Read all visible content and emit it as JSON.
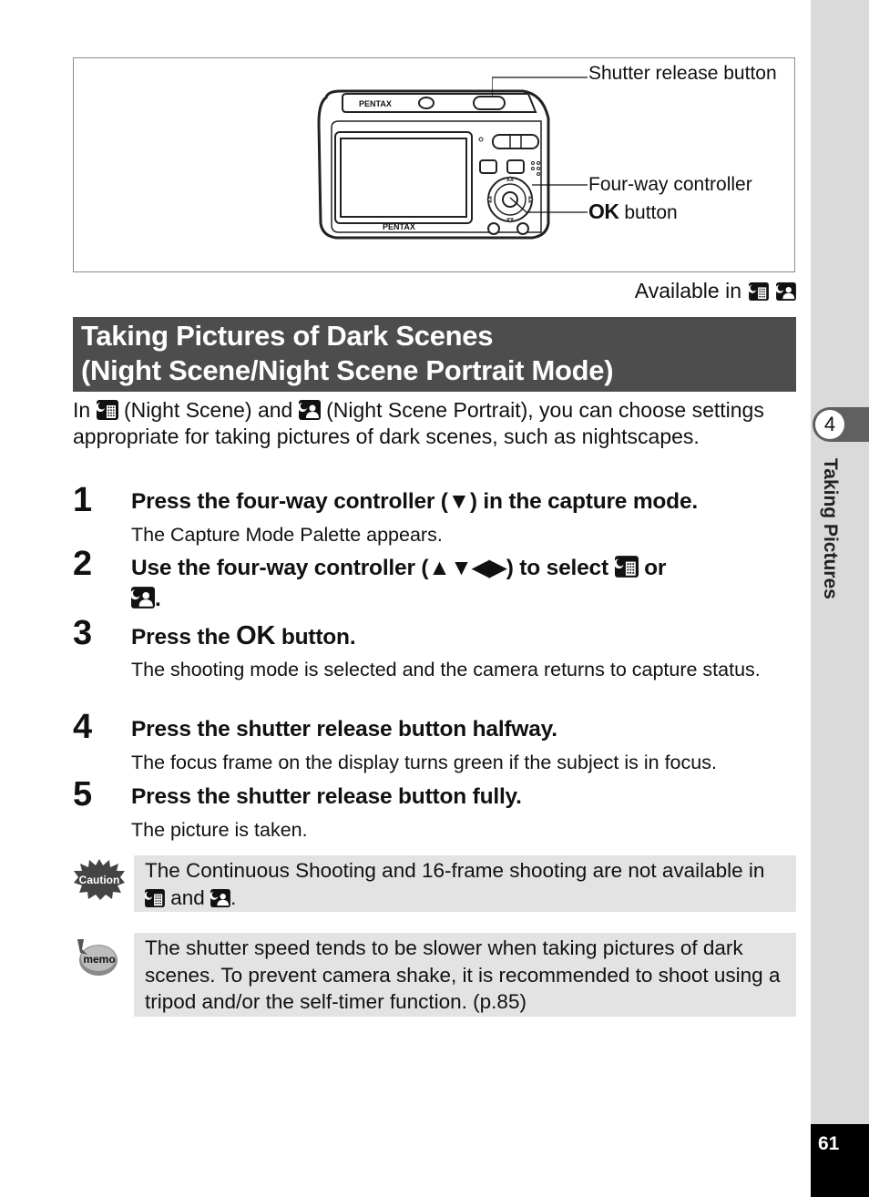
{
  "figure": {
    "brand_top": "PENTAX",
    "brand_bottom": "PENTAX",
    "callouts": {
      "shutter": "Shutter release button",
      "four_way": "Four-way controller",
      "ok_glyph": "OK",
      "ok_suffix": "button"
    }
  },
  "available": {
    "label": "Available in",
    "icons": [
      "night-scene-icon",
      "night-scene-portrait-icon"
    ]
  },
  "title": {
    "line1": "Taking Pictures of Dark Scenes",
    "line2": "(Night Scene/Night Scene Portrait Mode)"
  },
  "intro": {
    "part1": "In",
    "part2": "(Night Scene) and",
    "part3": "(Night Scene Portrait), you can choose settings appropriate for taking pictures of dark scenes, such as nightscapes."
  },
  "steps": [
    {
      "num": "1",
      "head": "Press the four-way controller (▼) in the capture mode.",
      "body": "The Capture Mode Palette appears."
    },
    {
      "num": "2",
      "head_a": "Use the four-way controller (▲▼◀▶) to select",
      "head_b": "or",
      "head_c": "."
    },
    {
      "num": "3",
      "head_a": "Press the",
      "ok": "OK",
      "head_b": "button.",
      "body": "The shooting mode is selected and the camera returns to capture status."
    },
    {
      "num": "4",
      "head": "Press the shutter release button halfway.",
      "body": "The focus frame on the display turns green if the subject is in focus."
    },
    {
      "num": "5",
      "head": "Press the shutter release button fully.",
      "body": "The picture is taken."
    }
  ],
  "caution": {
    "icon_label": "Caution",
    "text_a": "The Continuous Shooting and 16-frame shooting are not available in",
    "text_b": "and",
    "text_c": "."
  },
  "memo": {
    "icon_label": "memo",
    "text": "The shutter speed tends to be slower when taking pictures of dark scenes. To prevent camera shake, it is recommended to shoot using a tripod and/or the self-timer function. (p.85)"
  },
  "side_tab": {
    "chapter_number": "4",
    "chapter_title": "Taking Pictures"
  },
  "page_number": "61",
  "colors": {
    "title_bar": "#4d4d4d",
    "note_bg": "#e3e3e3",
    "side_strip": "#dadada"
  }
}
